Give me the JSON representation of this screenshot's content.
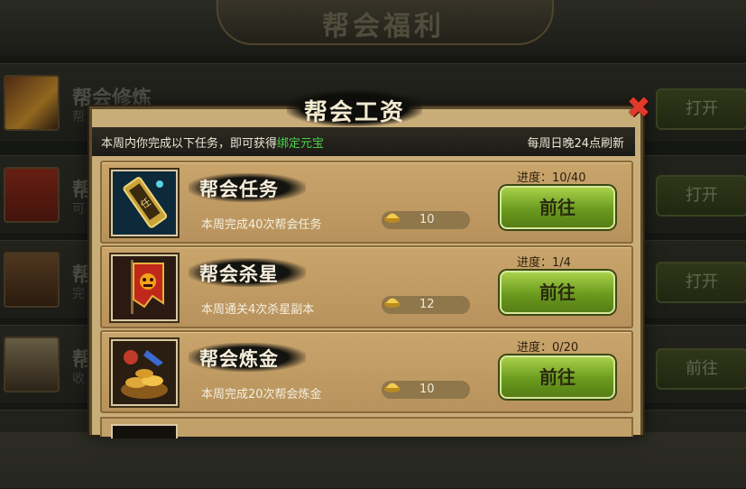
{
  "background": {
    "title": "帮会福利",
    "rows": [
      {
        "title": "帮会修炼",
        "sub": "帮",
        "button": "打开"
      },
      {
        "title": "帮",
        "sub": "可",
        "button": "打开"
      },
      {
        "title": "帮",
        "sub": "完",
        "button": "打开"
      },
      {
        "title": "帮",
        "sub": "收",
        "button": "前往"
      }
    ]
  },
  "dialog": {
    "title": "帮会工资",
    "info_prefix": "本周内你完成以下任务，即可获得",
    "info_highlight": "绑定元宝",
    "refresh_note": "每周日晚24点刷新",
    "tasks": [
      {
        "name": "帮会任务",
        "desc": "本周完成40次帮会任务",
        "reward": "10",
        "progress": "进度：10/40",
        "button": "前往",
        "icon": "quest-token-icon"
      },
      {
        "name": "帮会杀星",
        "desc": "本周通关4次杀星副本",
        "reward": "12",
        "progress": "进度：1/4",
        "button": "前往",
        "icon": "demon-banner-icon"
      },
      {
        "name": "帮会炼金",
        "desc": "本周完成20次帮会炼金",
        "reward": "10",
        "progress": "进度：0/20",
        "button": "前往",
        "icon": "gold-pile-icon"
      }
    ]
  },
  "colors": {
    "highlight": "#4bd34b",
    "close": "#e23a2a",
    "button": "#7aa626"
  }
}
